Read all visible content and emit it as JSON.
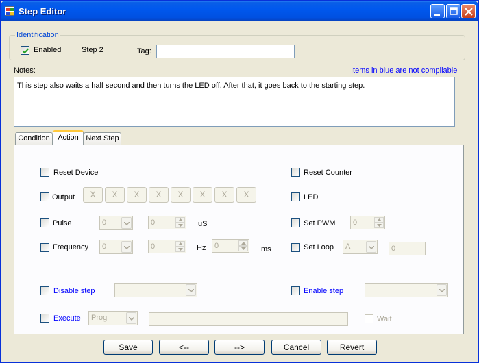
{
  "window": {
    "title": "Step Editor"
  },
  "identification": {
    "legend": "Identification",
    "enabled_label": "Enabled",
    "enabled_checked": true,
    "step_label": "Step 2",
    "tag_label": "Tag:",
    "tag_value": ""
  },
  "notes": {
    "label": "Notes:",
    "hint": "Items in blue are not compilable",
    "text": "This step also waits a half second and then turns the LED off. After that, it goes back to the starting step."
  },
  "tabs": [
    {
      "label": "Condition",
      "active": false
    },
    {
      "label": "Action",
      "active": true
    },
    {
      "label": "Next Step",
      "active": false
    }
  ],
  "action": {
    "reset_device": "Reset Device",
    "reset_counter": "Reset Counter",
    "output": "Output",
    "output_bits": [
      "X",
      "X",
      "X",
      "X",
      "X",
      "X",
      "X",
      "X"
    ],
    "led": "LED",
    "pulse": "Pulse",
    "pulse_value": "0",
    "pulse_duration": "0",
    "pulse_unit": "uS",
    "set_pwm": "Set PWM",
    "pwm_value": "0",
    "frequency": "Frequency",
    "freq_value": "0",
    "freq_amount": "0",
    "freq_unit": "Hz",
    "freq_time": "0",
    "freq_time_unit": "ms",
    "set_loop": "Set Loop",
    "loop_select": "A",
    "loop_value": "0",
    "disable_step": "Disable step",
    "disable_step_value": "",
    "enable_step": "Enable step",
    "enable_step_value": "",
    "execute": "Execute",
    "execute_select": "Prog",
    "execute_path": "",
    "wait": "Wait"
  },
  "buttons": {
    "save": "Save",
    "prev": "<--",
    "next": "-->",
    "cancel": "Cancel",
    "revert": "Revert"
  },
  "icons": {
    "app": "app-grid-icon",
    "minimize": "minimize-icon",
    "maximize": "maximize-icon",
    "close": "close-icon",
    "check": "check-icon",
    "dropdown": "chevron-down-icon",
    "spin_up": "chevron-up-icon",
    "spin_down": "chevron-down-icon"
  },
  "colors": {
    "titlebar": "#0058ee",
    "window_bg": "#ece9d8",
    "legend_text": "#0046d5",
    "not_compilable": "#0000ff"
  }
}
